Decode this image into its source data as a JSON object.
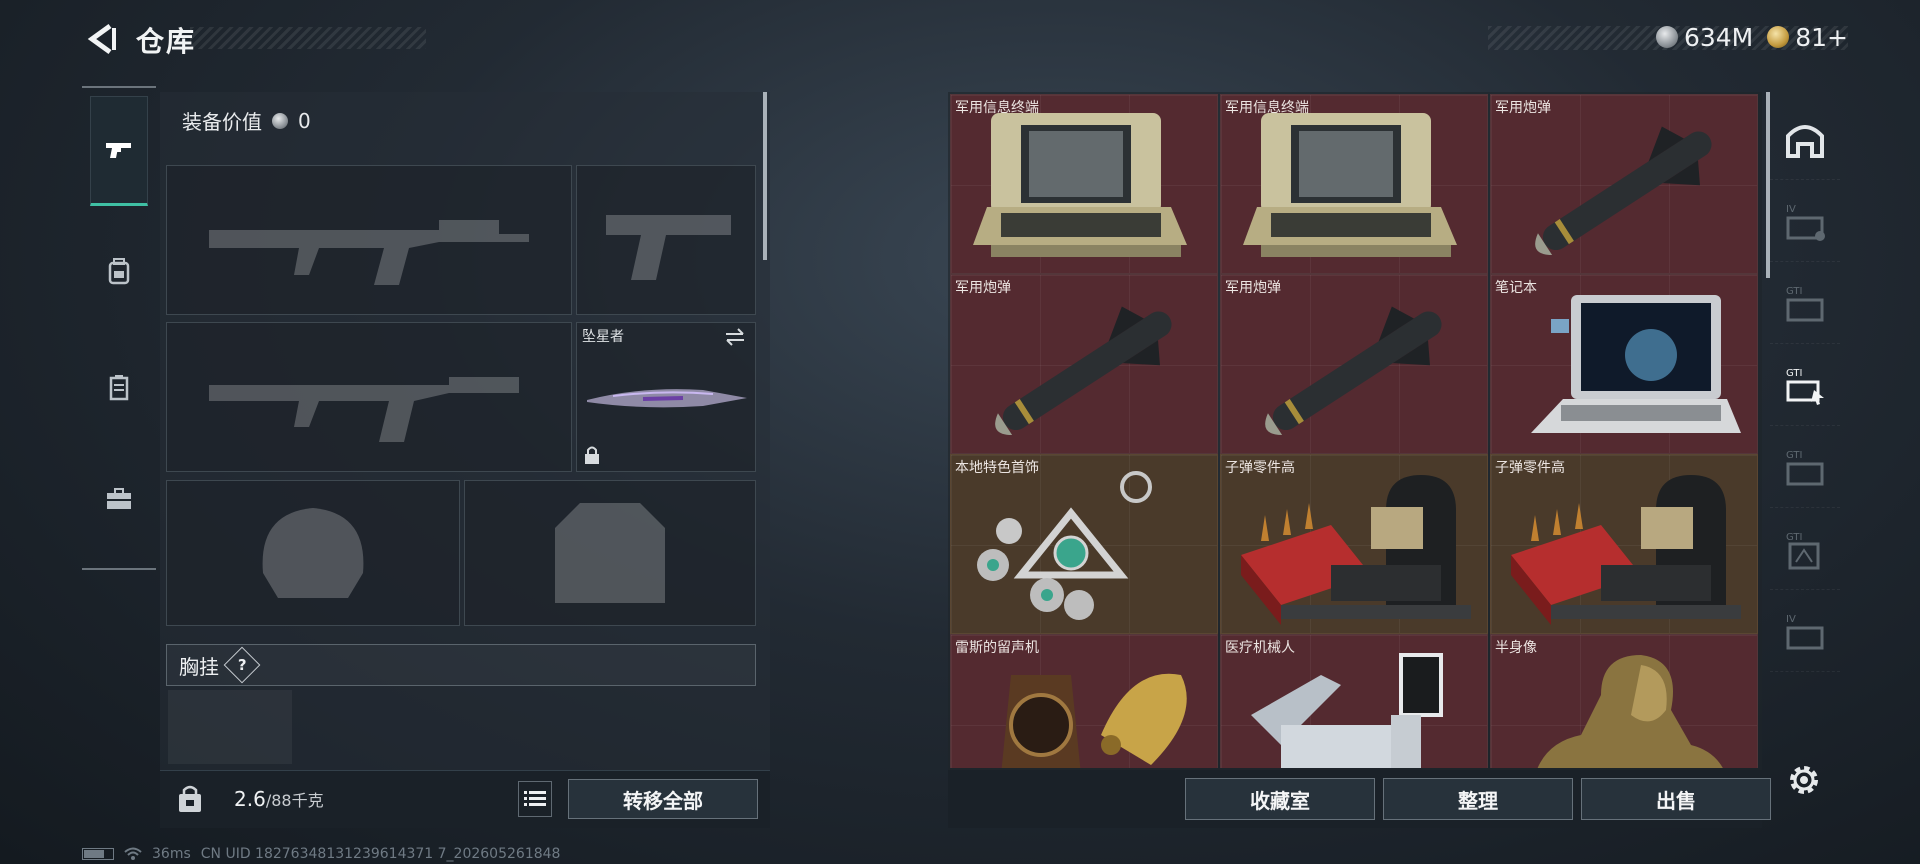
{
  "header": {
    "title": "仓库",
    "currency_silver": "634M",
    "currency_gold": "81+"
  },
  "loadout": {
    "equip_value_label": "装备价值",
    "equip_value": "0",
    "melee_slot_label": "坠星者",
    "chest_label": "胸挂",
    "help_mark": "?",
    "weight_current": "2.6",
    "weight_max": "/88千克",
    "transfer_all": "转移全部"
  },
  "storage": {
    "items": [
      {
        "label": "军用信息终端",
        "icon": "field-terminal-case"
      },
      {
        "label": "军用信息终端",
        "icon": "field-terminal-case"
      },
      {
        "label": "军用炮弹",
        "icon": "missile"
      },
      {
        "label": "军用炮弹",
        "icon": "missile"
      },
      {
        "label": "军用炮弹",
        "icon": "missile"
      },
      {
        "label": "笔记本",
        "icon": "rugged-laptop"
      },
      {
        "label": "本地特色首饰",
        "icon": "jewelry-keychain"
      },
      {
        "label": "子弹零件高",
        "icon": "ammo-parts-tray"
      },
      {
        "label": "子弹零件高",
        "icon": "ammo-parts-tray"
      },
      {
        "label": "雷斯的留声机",
        "icon": "gramophone"
      },
      {
        "label": "医疗机械人",
        "icon": "medical-robot"
      },
      {
        "label": "半身像",
        "icon": "bronze-bust"
      }
    ],
    "collection_room": "收藏室",
    "organize": "整理",
    "sell": "出售"
  },
  "status": {
    "ping": "36ms",
    "uid": "CN UID 18276348131239614371 7_202605261848"
  },
  "colors": {
    "rare_red": "#542a30",
    "tan": "#4a3a2a",
    "active_tab_accent": "#3fc0a4"
  }
}
